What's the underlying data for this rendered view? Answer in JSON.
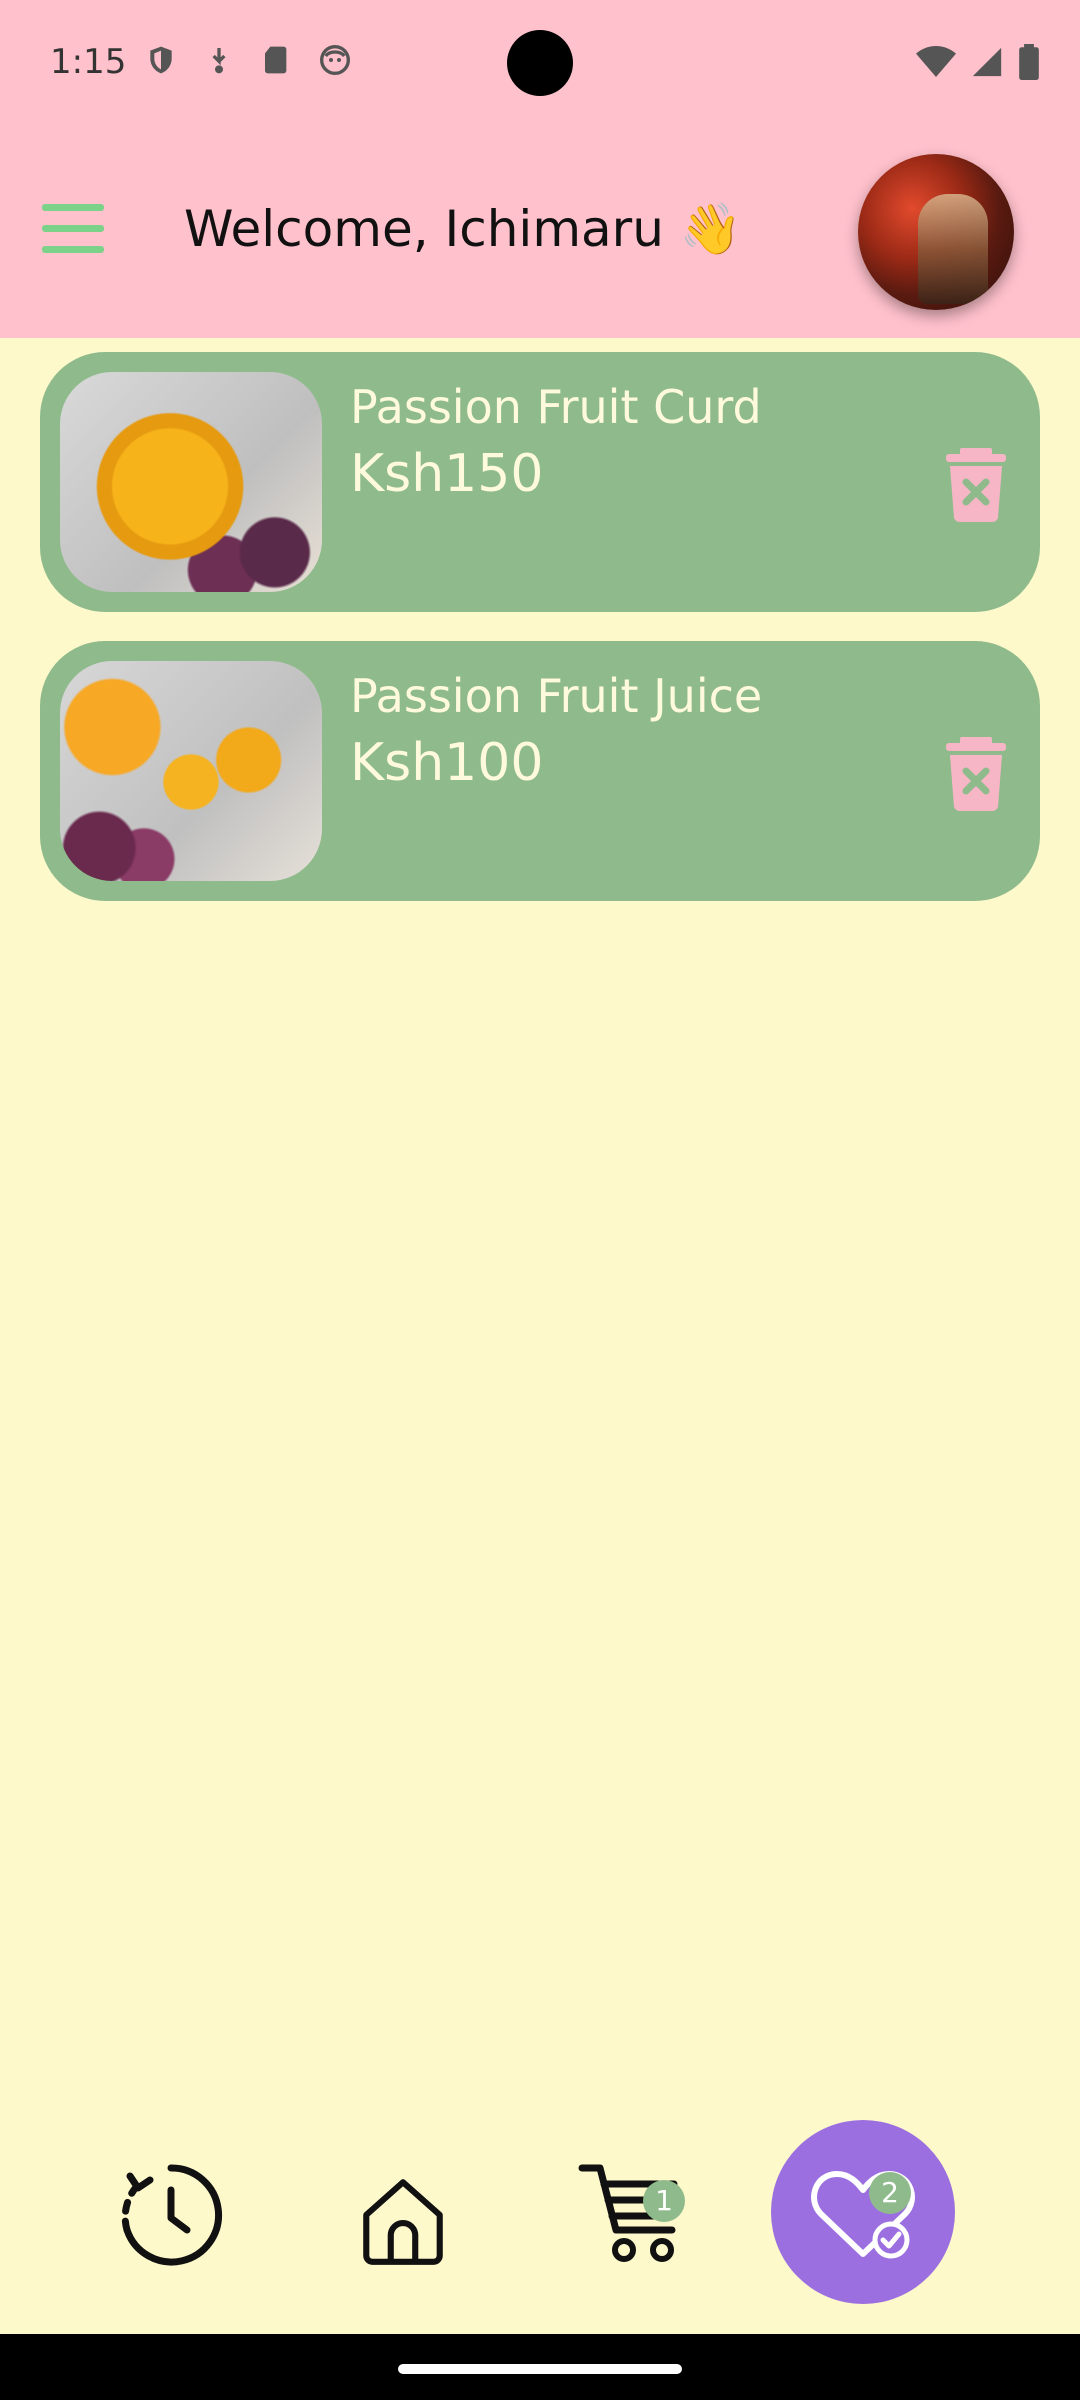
{
  "status_bar": {
    "time": "1:15"
  },
  "header": {
    "welcome_text": "Welcome, Ichimaru 👋"
  },
  "cart_items": [
    {
      "name": "Passion Fruit Curd",
      "price": "Ksh150"
    },
    {
      "name": "Passion Fruit Juice",
      "price": "Ksh100"
    }
  ],
  "bottom_nav": {
    "items": [
      "history-icon",
      "home-icon",
      "cart-icon",
      "favorites-icon"
    ],
    "cart_badge": "1",
    "favorites_badge": "2",
    "active": "favorites"
  },
  "colors": {
    "header_bg": "#FFC1CC",
    "page_bg": "#FEF9CB",
    "card_bg": "#8FBB8C",
    "accent_purple": "#9B6FE0",
    "delete_pink": "#F7B6C6"
  }
}
